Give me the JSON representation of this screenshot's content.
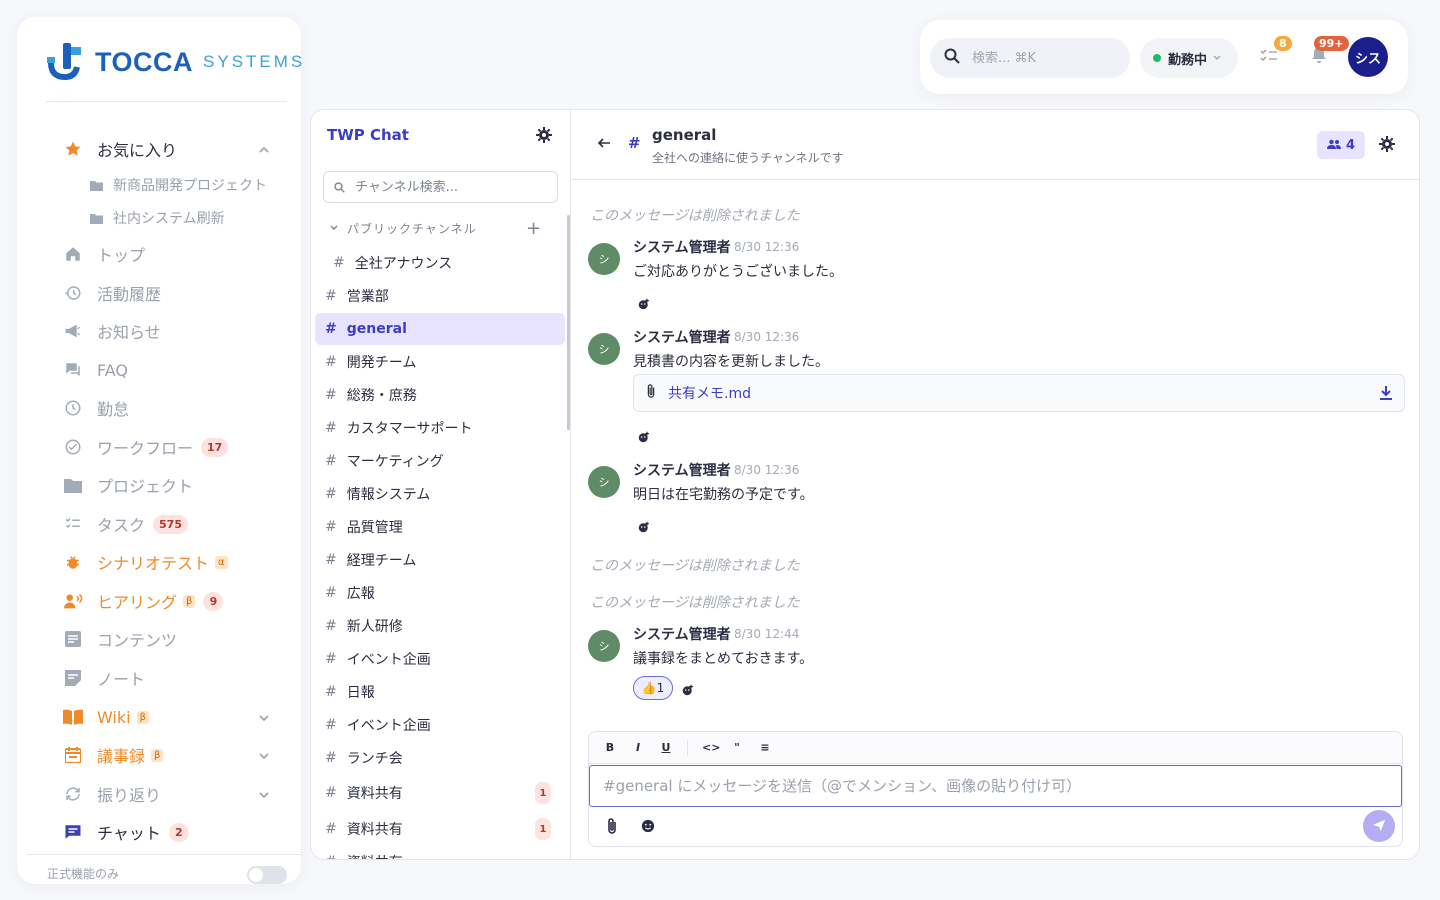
{
  "brand": {
    "name": "TOCCA",
    "sub": "SYSTEMS",
    "primary": "#1d5fbd",
    "accent": "#3aa0dc"
  },
  "sidebar": {
    "favorites": {
      "label": "お気に入り",
      "icon": "star-icon",
      "items": [
        "新商品開発プロジェクト",
        "社内システム刷新"
      ]
    },
    "items": [
      {
        "label": "トップ",
        "icon": "home-icon"
      },
      {
        "label": "活動履歴",
        "icon": "history-icon"
      },
      {
        "label": "お知らせ",
        "icon": "megaphone-icon"
      },
      {
        "label": "FAQ",
        "icon": "faq-icon"
      },
      {
        "label": "勤怠",
        "icon": "clock-icon"
      },
      {
        "label": "ワークフロー",
        "icon": "check-circle-icon",
        "count": "17"
      },
      {
        "label": "プロジェクト",
        "icon": "folder-icon"
      },
      {
        "label": "タスク",
        "icon": "task-list-icon",
        "count": "575"
      },
      {
        "label": "シナリオテスト",
        "icon": "bug-icon",
        "badge": "α"
      },
      {
        "label": "ヒアリング",
        "icon": "hearing-icon",
        "badge": "β",
        "count": "9"
      },
      {
        "label": "コンテンツ",
        "icon": "article-icon"
      },
      {
        "label": "ノート",
        "icon": "note-icon"
      },
      {
        "label": "Wiki",
        "icon": "book-icon",
        "badge": "β"
      },
      {
        "label": "議事録",
        "icon": "calendar-icon",
        "badge": "β"
      },
      {
        "label": "振り返り",
        "icon": "refresh-icon"
      },
      {
        "label": "チャット",
        "icon": "chat-icon",
        "count": "2"
      }
    ],
    "footer_label": "正式機能のみ"
  },
  "topbar": {
    "search_placeholder": "検索... ⌘K",
    "status": "勤務中",
    "task_badge": "8",
    "notif_badge": "99+",
    "avatar": "シス"
  },
  "chat": {
    "app_title": "TWP Chat",
    "search_placeholder": "チャンネル検索...",
    "section": "パブリックチャンネル",
    "channels": [
      {
        "name": "全社アナウンス"
      },
      {
        "name": "営業部"
      },
      {
        "name": "general"
      },
      {
        "name": "開発チーム"
      },
      {
        "name": "総務・庶務"
      },
      {
        "name": "カスタマーサポート"
      },
      {
        "name": "マーケティング"
      },
      {
        "name": "情報システム"
      },
      {
        "name": "品質管理"
      },
      {
        "name": "経理チーム"
      },
      {
        "name": "広報"
      },
      {
        "name": "新人研修"
      },
      {
        "name": "イベント企画"
      },
      {
        "name": "日報"
      },
      {
        "name": "イベント企画"
      },
      {
        "name": "ランチ会"
      },
      {
        "name": "資料共有",
        "unread": "1"
      },
      {
        "name": "資料共有",
        "unread": "1"
      },
      {
        "name": "資料共有"
      }
    ],
    "header": {
      "name": "general",
      "description": "全社への連絡に使うチャンネルです",
      "members": "4"
    },
    "deleted_text": "このメッセージは削除されました",
    "messages": [
      {
        "author": "システム管理者",
        "avatar": "シ",
        "time": "8/30 12:36",
        "text": "ご対応ありがとうございました。"
      },
      {
        "author": "システム管理者",
        "avatar": "シ",
        "time": "8/30 12:36",
        "text": "見積書の内容を更新しました。",
        "attachment": "共有メモ.md"
      },
      {
        "author": "システム管理者",
        "avatar": "シ",
        "time": "8/30 12:36",
        "text": "明日は在宅勤務の予定です。"
      },
      {
        "author": "システム管理者",
        "avatar": "シ",
        "time": "8/30 12:44",
        "text": "議事録をまとめておきます。",
        "reaction": "👍1"
      }
    ],
    "composer": {
      "placeholder": "#general にメッセージを送信（@でメンション、画像の貼り付け可）",
      "toolbar": [
        "B",
        "I",
        "U",
        "<>",
        "\"",
        "≡"
      ]
    }
  }
}
